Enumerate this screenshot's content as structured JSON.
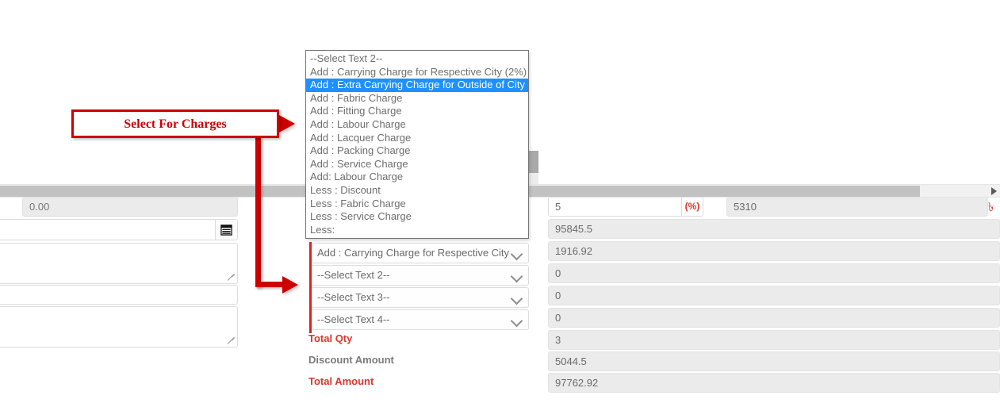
{
  "annotation": {
    "callout_text": "Select For Charges",
    "color": "#cc0000"
  },
  "scrollbar": {
    "arrow_right_icon": "triangle-right-icon"
  },
  "left_panel": {
    "amount_field": {
      "value": "",
      "placeholder": "0.00"
    },
    "date_field": {
      "value": "",
      "placeholder": ""
    },
    "calendar_icon": "calendar-icon",
    "note_area_1": {
      "value": "",
      "placeholder": ""
    },
    "narration_field": {
      "value": "",
      "placeholder": ""
    },
    "note_area_2": {
      "value": "",
      "placeholder": ""
    }
  },
  "dropdown": {
    "open": true,
    "selected_index": 2,
    "highlight_color": "#1e90ff",
    "options": [
      "--Select Text 2--",
      "Add : Carrying Charge for Respective City (2%)",
      "Add : Extra Carrying Charge for Outside of City",
      "Add : Fabric Charge",
      "Add : Fitting Charge",
      "Add : Labour Charge",
      "Add : Lacquer Charge",
      "Add : Packing Charge",
      "Add : Service Charge",
      "Add: Labour Charge",
      "Less : Discount",
      "Less : Fabric Charge",
      "Less : Service Charge",
      "Less:"
    ]
  },
  "charge_selects": [
    {
      "name": "charge-select-1",
      "value": "Add : Carrying Charge for Respective City",
      "chevron": "chevron-down-icon"
    },
    {
      "name": "charge-select-2",
      "value": "--Select Text 2--",
      "chevron": "chevron-down-icon"
    },
    {
      "name": "charge-select-3",
      "value": "--Select Text 3--",
      "chevron": "chevron-down-icon"
    },
    {
      "name": "charge-select-4",
      "value": "--Select Text 4--",
      "chevron": "chevron-down-icon"
    }
  ],
  "summary_labels": {
    "total_qty": "Total Qty",
    "discount_amount": "Discount Amount",
    "total_amount": "Total Amount"
  },
  "values": {
    "percent": "5",
    "percent_addon": "(%)",
    "percent_amount": "5310",
    "sub_total": "95845.5",
    "charge_1_amount": "1916.92",
    "charge_2_amount": "0",
    "charge_3_amount": "0",
    "charge_4_amount": "0",
    "total_qty": "3",
    "discount_amount": "5044.5",
    "total_amount": "97762.92",
    "currency_symbol": "৳"
  }
}
